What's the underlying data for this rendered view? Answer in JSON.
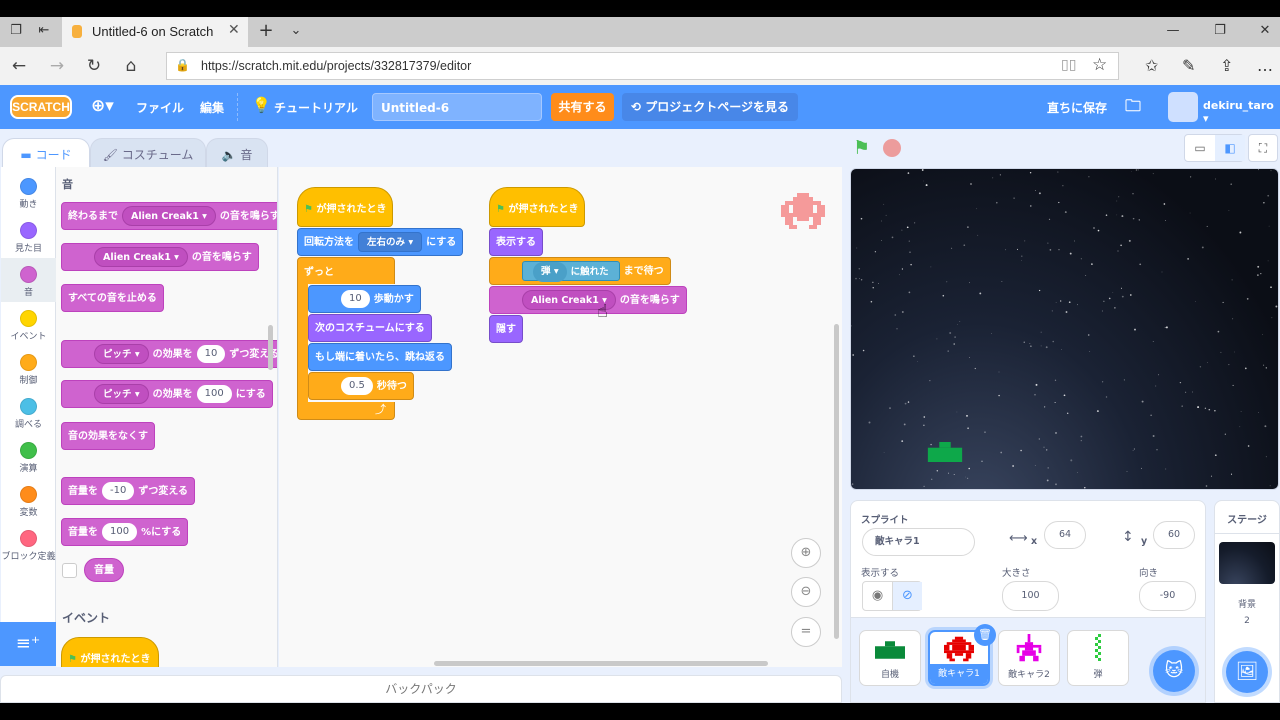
{
  "browser": {
    "tab_title": "Untitled-6 on Scratch",
    "url": "https://scratch.mit.edu/projects/332817379/editor"
  },
  "menubar": {
    "logo": "SCRATCH",
    "file": "ファイル",
    "edit": "編集",
    "tutorial": "チュートリアル",
    "project_title": "Untitled-6",
    "share": "共有する",
    "see_project_page": "プロジェクトページを見る",
    "save_now": "直ちに保存",
    "username": "dekiru_taro"
  },
  "editor_tabs": [
    "コード",
    "コスチューム",
    "音"
  ],
  "categories": [
    {
      "label": "動き",
      "color": "#4c97ff"
    },
    {
      "label": "見た目",
      "color": "#9966ff"
    },
    {
      "label": "音",
      "color": "#cf63cf"
    },
    {
      "label": "イベント",
      "color": "#ffd500"
    },
    {
      "label": "制御",
      "color": "#ffab19"
    },
    {
      "label": "調べる",
      "color": "#4cbfe6"
    },
    {
      "label": "演算",
      "color": "#40bf4a"
    },
    {
      "label": "変数",
      "color": "#ff8c1a"
    },
    {
      "label": "ブロック定義",
      "color": "#ff6680"
    }
  ],
  "palette": {
    "section_sound": "音",
    "play_until_done_pre": "終わるまで",
    "sound_name": "Alien Creak1",
    "play_until_done_post": "の音を鳴らす",
    "start_sound_post": "の音を鳴らす",
    "stop_all": "すべての音を止める",
    "effect_name": "ピッチ",
    "change_effect_mid": "の効果を",
    "change_effect_val": "10",
    "change_effect_post": "ずつ変える",
    "set_effect_val": "100",
    "set_effect_post": "にする",
    "clear_effects": "音の効果をなくす",
    "change_volume_pre": "音量を",
    "change_volume_val": "-10",
    "change_volume_post": "ずつ変える",
    "set_volume_pre": "音量を",
    "set_volume_val": "100",
    "set_volume_post": "%にする",
    "volume_reporter": "音量",
    "section_events": "イベント",
    "when_flag": "が押されたとき"
  },
  "script1": {
    "hat": "が押されたとき",
    "rotation_pre": "回転方法を",
    "rotation_val": "左右のみ",
    "rotation_post": "にする",
    "forever": "ずっと",
    "move_val": "10",
    "move_post": "歩動かす",
    "next_costume": "次のコスチュームにする",
    "bounce": "もし端に着いたら、跳ね返る",
    "wait_val": "0.5",
    "wait_post": "秒待つ"
  },
  "script2": {
    "hat": "が押されたとき",
    "show": "表示する",
    "touching_val": "弾",
    "touching_post": "に触れた",
    "wait_until_post": "まで待つ",
    "sound_val": "Alien Creak1",
    "sound_post": "の音を鳴らす",
    "hide": "隠す"
  },
  "backpack": "バックパック",
  "sprite_info": {
    "label_sprite": "スプライト",
    "name": "敵キャラ1",
    "x_label": "x",
    "x": "64",
    "y_label": "y",
    "y": "60",
    "label_show": "表示する",
    "label_size": "大きさ",
    "size": "100",
    "label_direction": "向き",
    "direction": "-90"
  },
  "sprites": [
    {
      "name": "自機",
      "color": "#0a8a3a",
      "selected": false
    },
    {
      "name": "敵キャラ1",
      "color": "#e60000",
      "selected": true
    },
    {
      "name": "敵キャラ2",
      "color": "#e600e6",
      "selected": false
    },
    {
      "name": "弾",
      "color": "#2ecc40",
      "selected": false
    }
  ],
  "stage_panel": {
    "title": "ステージ",
    "backdrops_label": "背景",
    "backdrops_count": "2"
  }
}
